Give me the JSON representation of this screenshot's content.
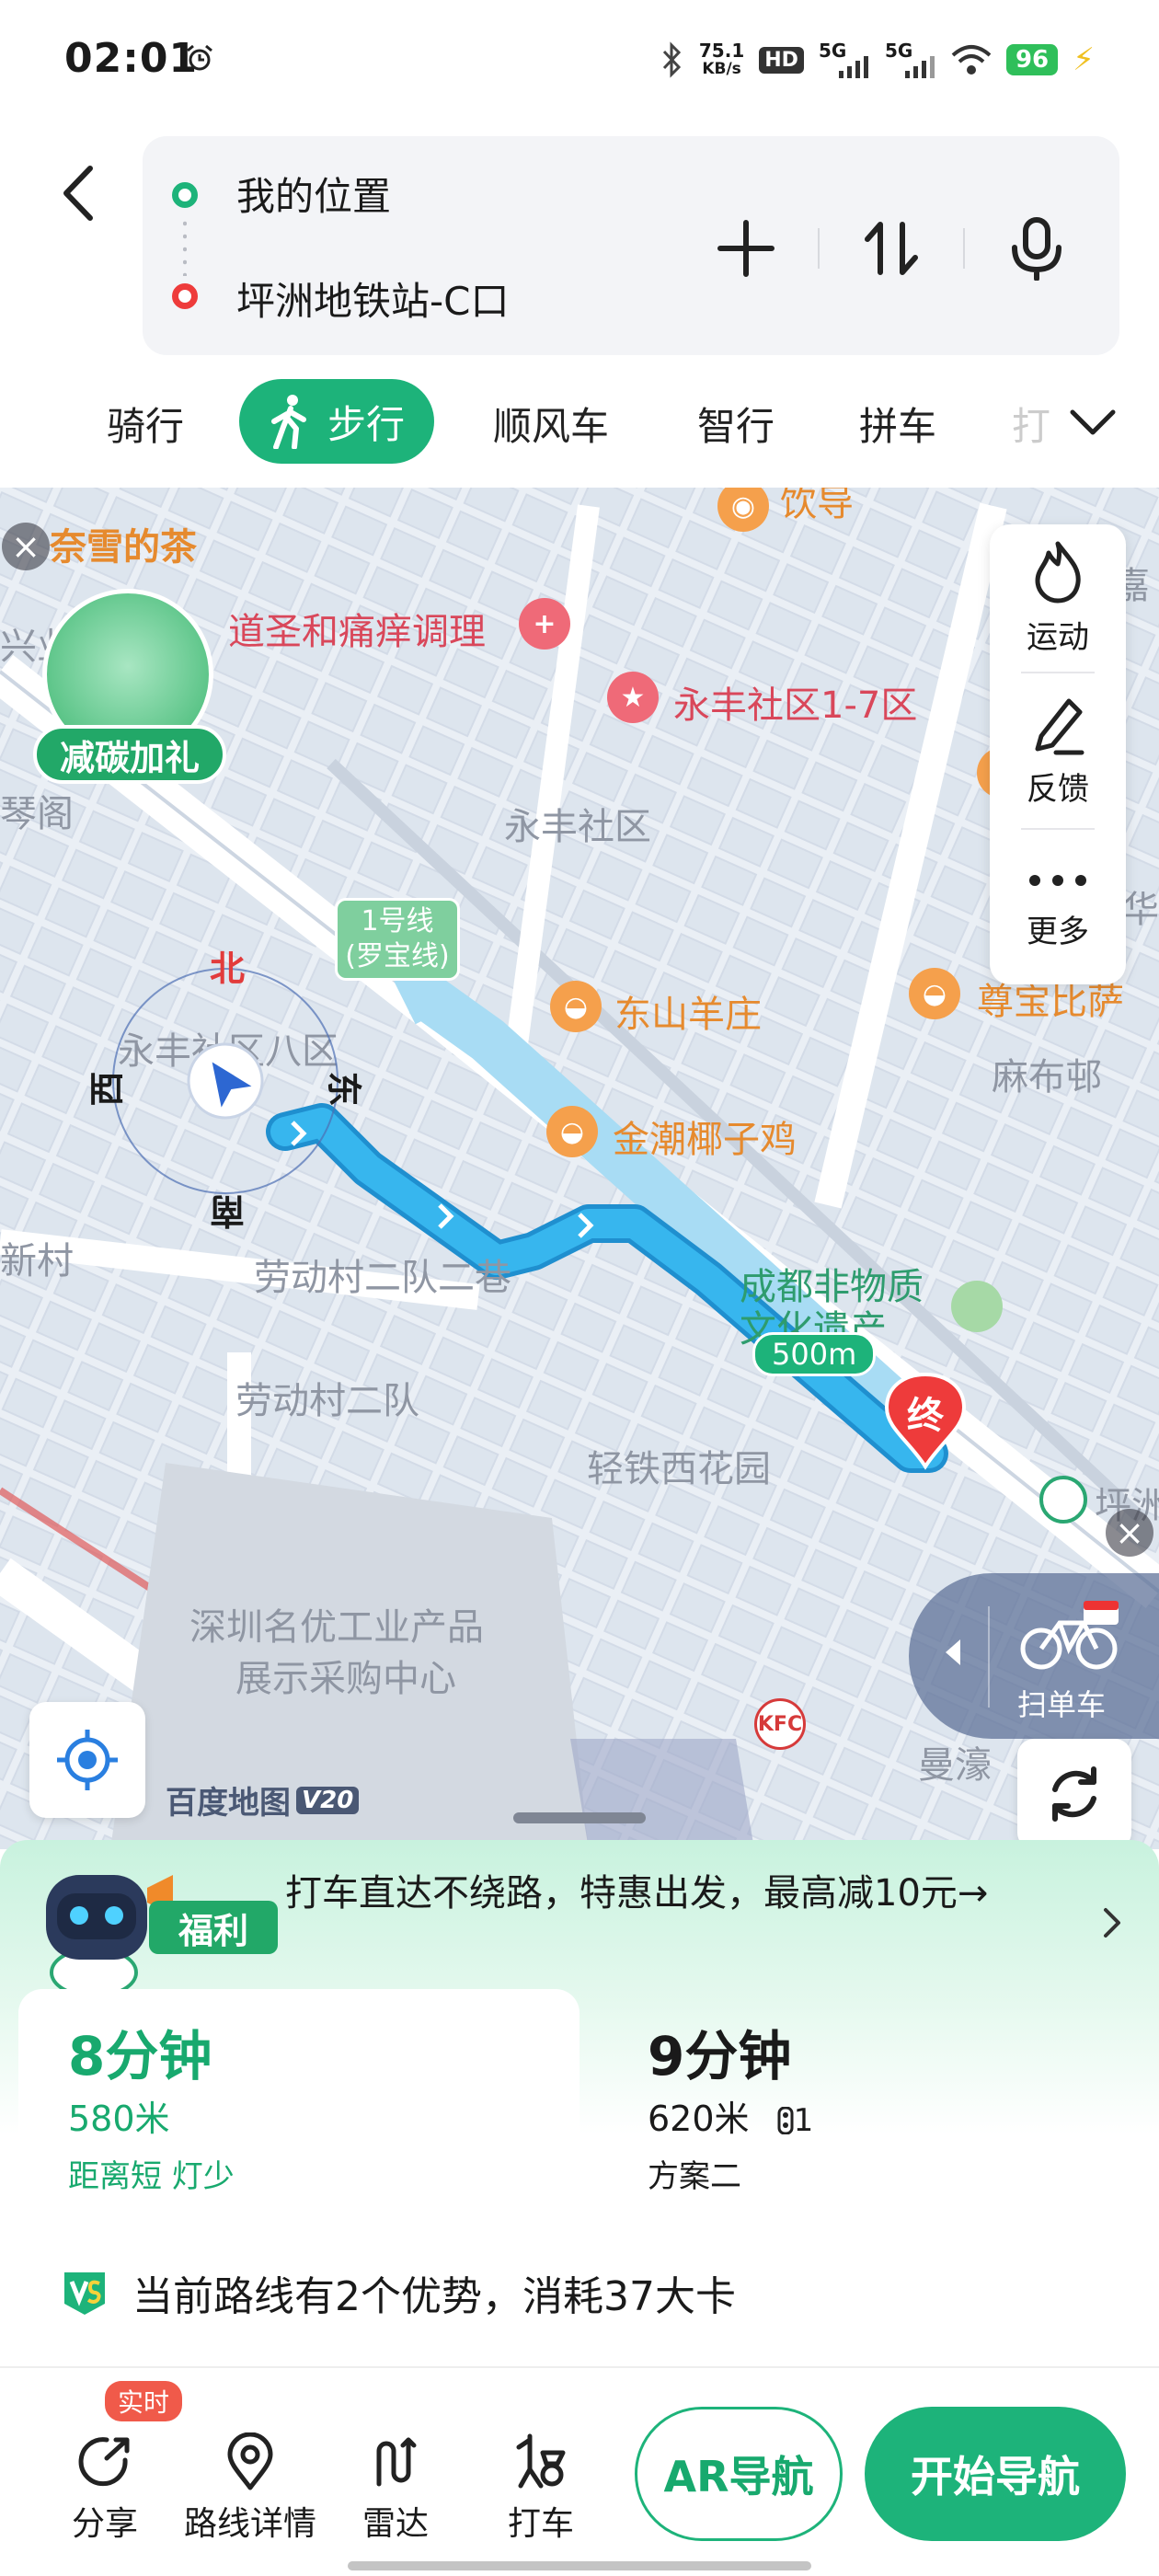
{
  "status_bar": {
    "time": "02:01",
    "net_speed": "75.1",
    "net_speed_unit": "KB/s",
    "hd_label": "HD",
    "sig1_label": "5G",
    "sig2_label": "5G",
    "battery": "96"
  },
  "search": {
    "from": "我的位置",
    "to": "坪洲地铁站-C口"
  },
  "modes": {
    "items": [
      "骑行",
      "步行",
      "顺风车",
      "智行",
      "拼车"
    ],
    "active": "步行",
    "faded": "打"
  },
  "map": {
    "labels": {
      "naixue": "奈雪的茶",
      "daosheng": "道圣和痛痒调理",
      "yongfeng17": "永丰社区1-7区",
      "yongfeng": "永丰社区",
      "line1": "1号线(罗宝线)",
      "dongshan": "东山羊庄",
      "zunbao": "尊宝比萨",
      "mabubu": "麻布邨",
      "jinchao": "金潮椰子鸡",
      "yongfeng8": "永丰社区八区",
      "laodong2": "劳动村二队二巷",
      "laodong": "劳动村二队",
      "chengdu": "成都非物质文化遗产",
      "qingtie": "轻铁西花园",
      "shenzhen1": "深圳名优工业产品",
      "shenzhen2": "展示采购中心",
      "xincun": "新村",
      "pingzhou": "坪洲",
      "manhao": "曼濠",
      "qinge": "琴阁",
      "yinshao": "饮导",
      "xing": "兴业",
      "jia": "嘉",
      "hua": "华"
    },
    "promo_label": "减碳加礼",
    "tools": [
      {
        "icon": "flame-icon",
        "label": "运动"
      },
      {
        "icon": "pen-icon",
        "label": "反馈"
      },
      {
        "icon": "more-icon",
        "label": "更多"
      }
    ],
    "compass": {
      "north": "北",
      "south": "南",
      "east": "东",
      "west": "西"
    },
    "distance_chip": "500m",
    "end_label": "终",
    "bike_label": "扫单车",
    "brand": "百度地图",
    "brand_version": "V20"
  },
  "sheet": {
    "welfare_badge": "福利",
    "welfare_text": "打车直达不绕路，特惠出发，最高减10元→",
    "plans": [
      {
        "time": "8分钟",
        "distance": "580米",
        "tag": "距离短 灯少",
        "lights": ""
      },
      {
        "time": "9分钟",
        "distance": "620米",
        "tag": "方案二",
        "lights": "1"
      }
    ],
    "advantage": "当前路线有2个优势，消耗37大卡"
  },
  "bottom_bar": {
    "live_badge": "实时",
    "items": [
      {
        "icon": "share-icon",
        "label": "分享"
      },
      {
        "icon": "route-detail-icon",
        "label": "路线详情"
      },
      {
        "icon": "radar-icon",
        "label": "雷达"
      },
      {
        "icon": "taxi-icon",
        "label": "打车"
      }
    ],
    "ar_nav": "AR导航",
    "start_nav": "开始导航"
  },
  "colors": {
    "accent": "#1db37a",
    "route": "#2aa8e6",
    "end_marker": "#ee3b3b"
  }
}
